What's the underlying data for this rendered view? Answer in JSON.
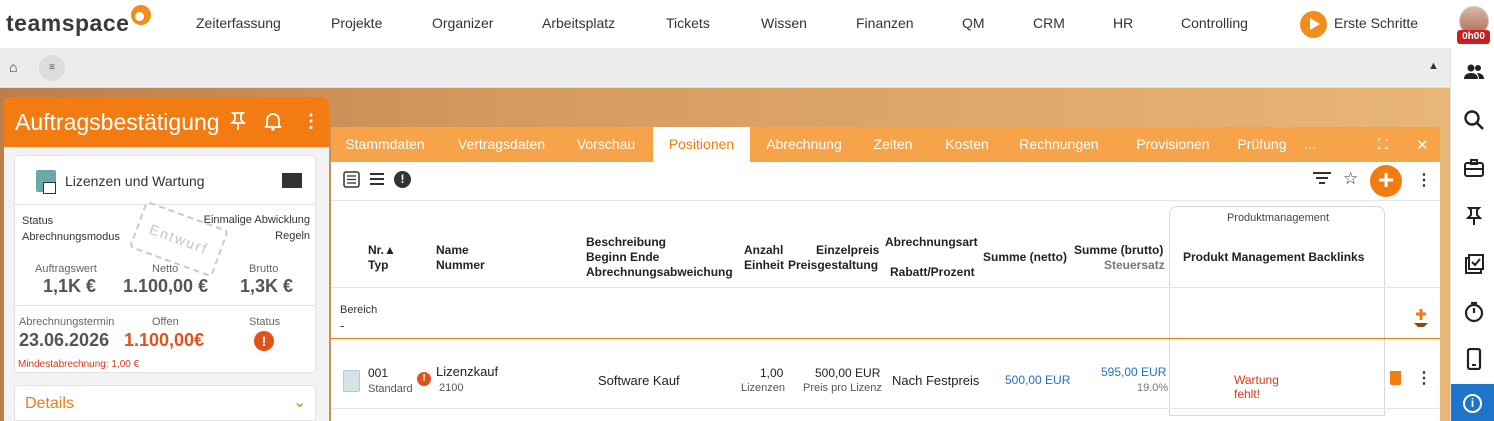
{
  "topnav": {
    "logo": "teamspace",
    "items": [
      "Zeiterfassung",
      "Projekte",
      "Organizer",
      "Arbeitsplatz",
      "Tickets",
      "Wissen",
      "Finanzen",
      "QM",
      "CRM",
      "HR",
      "Controlling"
    ],
    "erste_schritte": "Erste Schritte",
    "time_badge": "0h00"
  },
  "subbar": {
    "home": "⌂",
    "menu": "≡",
    "collapse": "▲"
  },
  "left_panel": {
    "title": "Auftragsbestätigung",
    "card_title": "Lizenzen und Wartung",
    "status_label": "Status",
    "status_value": "Einmalige Abwicklung",
    "mode_label": "Abrechnungsmodus",
    "mode_value": "Regeln",
    "stamp": "Entwurf",
    "auftragswert_label": "Auftragswert",
    "auftragswert": "1,1K €",
    "netto_label": "Netto",
    "netto": "1.100,00 €",
    "brutto_label": "Brutto",
    "brutto": "1,3K €",
    "termin_label": "Abrechnungstermin",
    "termin": "23.06.2026",
    "offen_label": "Offen",
    "offen": "1.100,00€",
    "status2_label": "Status",
    "mindest": "Mindestabrechnung: 1,00 €",
    "details": "Details"
  },
  "tabs": [
    "Stammdaten",
    "Vertragsdaten",
    "Vorschau",
    "Positionen",
    "Abrechnung",
    "Zeiten",
    "Kosten",
    "Rechnungen",
    "Provisionen",
    "Prüfung",
    "..."
  ],
  "active_tab": "Positionen",
  "table": {
    "group_label": "Produktmanagement",
    "headers": {
      "nr": "Nr.▲",
      "typ": "Typ",
      "name": "Name",
      "nummer": "Nummer",
      "beschreibung": "Beschreibung",
      "beginn_ende": "Beginn Ende",
      "abweichung": "Abrechnungsabweichung",
      "anzahl": "Anzahl",
      "einheit": "Einheit",
      "einzelpreis": "Einzelpreis",
      "preisgestaltung": "Preisgestaltung",
      "abrechnungsart": "Abrechnungsart",
      "rabatt": "Rabatt/Prozent",
      "summe_netto": "Summe (netto)",
      "summe_brutto": "Summe (brutto)",
      "steuersatz": "Steuersatz",
      "backlinks": "Produkt Management Backlinks"
    },
    "filter": {
      "label": "Bereich",
      "value": "-"
    },
    "rows": [
      {
        "nr": "001",
        "typ": "Standard",
        "name": "Lizenzkauf",
        "nummer": "2100",
        "beschreibung": "Software Kauf",
        "anzahl": "1,00",
        "einheit": "Lizenzen",
        "einzelpreis": "500,00 EUR",
        "preisgestaltung": "Preis pro Lizenz",
        "abrechnungsart": "Nach Festpreis",
        "summe_netto": "500,00 EUR",
        "summe_brutto": "595,00 EUR",
        "steuersatz": "19.0%",
        "backlink_warning_1": "Wartung",
        "backlink_warning_2": "fehlt!"
      }
    ]
  },
  "colors": {
    "accent": "#f27c12",
    "tabbar": "#f7a34a",
    "blue": "#1f72c4",
    "red": "#d7391f",
    "info": "#1d74c9"
  },
  "icons": [
    "home-icon",
    "menu-icon",
    "pin-icon",
    "bell-icon",
    "more-icon",
    "grid-icon",
    "warning-icon",
    "chevron-down-icon",
    "expand-icon",
    "close-icon",
    "list-view-icon",
    "list-icon",
    "filter-icon",
    "star-icon",
    "add-icon",
    "people-icon",
    "search-icon",
    "briefcase-icon",
    "checklist-icon",
    "timer-icon",
    "phone-icon",
    "info-icon",
    "trash-icon",
    "download-icon"
  ]
}
